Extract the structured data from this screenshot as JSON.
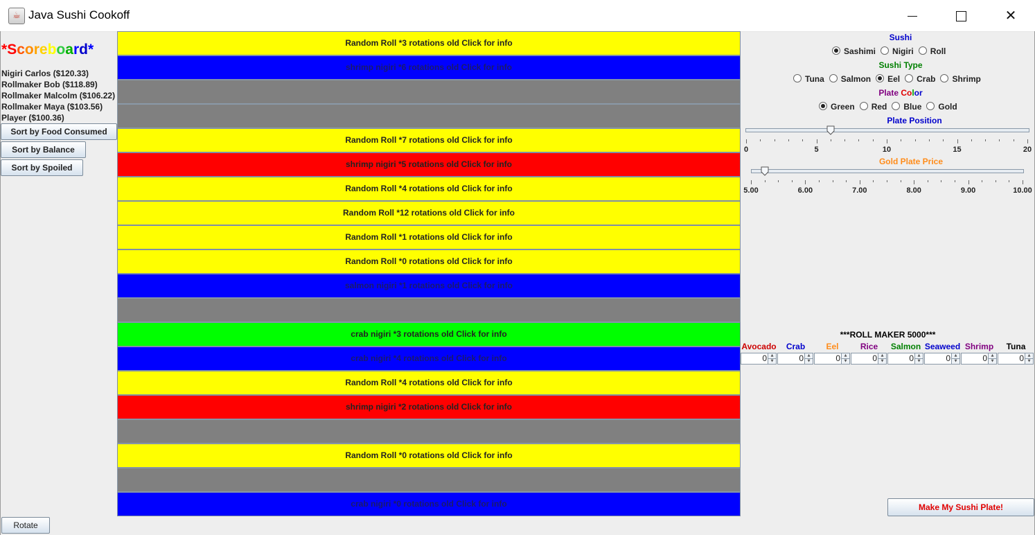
{
  "window": {
    "title": "Java Sushi Cookoff",
    "minimize_glyph": "minimize",
    "maximize_glyph": "maximize",
    "close_glyph": "✕"
  },
  "scoreboard": {
    "title_chars": [
      "*",
      "S",
      "c",
      "o",
      "r",
      "e",
      "b",
      "o",
      "a",
      "r",
      "d",
      "*"
    ],
    "title_colors": [
      "#ff0000",
      "#ff0000",
      "#ff5500",
      "#ff8c00",
      "#ffa500",
      "#ffd200",
      "#ffff00",
      "#2ecc40",
      "#00b000",
      "#0000ff",
      "#0000cc",
      "#0000ff"
    ],
    "entries": [
      "Nigiri Carlos ($120.33)",
      "Rollmaker Bob ($118.89)",
      "Rollmaker Malcolm ($106.22)",
      "Rollmaker Maya ($103.56)",
      "Player ($100.36)"
    ],
    "sort_food_label": "Sort by Food Consumed",
    "sort_balance_label": "Sort by Balance",
    "sort_spoiled_label": "Sort by Spoiled",
    "rotate_label": "Rotate"
  },
  "belt": {
    "plates": [
      {
        "color": "yellow",
        "text": "Random Roll *3 rotations old Click for info"
      },
      {
        "color": "blue",
        "text": "shrimp nigiri *6 rotations old Click for info"
      },
      {
        "color": "gray",
        "text": ""
      },
      {
        "color": "gray",
        "text": ""
      },
      {
        "color": "yellow",
        "text": "Random Roll *7 rotations old Click for info"
      },
      {
        "color": "red",
        "text": "shrimp nigiri *5 rotations old Click for info"
      },
      {
        "color": "yellow",
        "text": "Random Roll *4 rotations old Click for info"
      },
      {
        "color": "yellow",
        "text": "Random Roll *12 rotations old Click for info"
      },
      {
        "color": "yellow",
        "text": "Random Roll *1 rotations old Click for info"
      },
      {
        "color": "yellow",
        "text": "Random Roll *0 rotations old Click for info"
      },
      {
        "color": "blue",
        "text": "salmon nigiri *1 rotations old Click for info"
      },
      {
        "color": "gray",
        "text": ""
      },
      {
        "color": "green",
        "text": "crab nigiri *3 rotations old Click for info"
      },
      {
        "color": "blue",
        "text": "crab nigiri *4 rotations old Click for info"
      },
      {
        "color": "yellow",
        "text": "Random Roll *4 rotations old Click for info"
      },
      {
        "color": "red",
        "text": "shrimp nigiri *2 rotations old Click for info"
      },
      {
        "color": "gray",
        "text": ""
      },
      {
        "color": "yellow",
        "text": "Random Roll *0 rotations old Click for info"
      },
      {
        "color": "gray",
        "text": ""
      },
      {
        "color": "blue",
        "text": "crab nigiri *0 rotations old Click for info"
      }
    ]
  },
  "controls": {
    "sushi_label": "Sushi",
    "sushi_options": [
      "Sashimi",
      "Nigiri",
      "Roll"
    ],
    "sushi_selected": "Sashimi",
    "type_label": "Sushi Type",
    "type_options": [
      "Tuna",
      "Salmon",
      "Eel",
      "Crab",
      "Shrimp"
    ],
    "type_selected": "Eel",
    "plate_color_label_chars": [
      "Plate ",
      "Co",
      "l",
      "or"
    ],
    "plate_color_label_colors": [
      "#800080",
      "#e00000",
      "#00a000",
      "#0000cc"
    ],
    "color_options": [
      "Green",
      "Red",
      "Blue",
      "Gold"
    ],
    "color_selected": "Green",
    "position_label": "Plate Position",
    "position_value": 6,
    "position_ticks": [
      "0",
      "5",
      "10",
      "15",
      "20"
    ],
    "price_label": "Gold Plate Price",
    "price_value": 5.25,
    "price_ticks": [
      "5.00",
      "6.00",
      "7.00",
      "8.00",
      "9.00",
      "10.00"
    ]
  },
  "roll_maker": {
    "title": "***ROLL MAKER 5000***",
    "ingredients": [
      {
        "name": "Avocado",
        "color": "#cc0000",
        "value": "0"
      },
      {
        "name": "Crab",
        "color": "#0000cc",
        "value": "0"
      },
      {
        "name": "Eel",
        "color": "#ff8c1a",
        "value": "0"
      },
      {
        "name": "Rice",
        "color": "#800080",
        "value": "0"
      },
      {
        "name": "Salmon",
        "color": "#008000",
        "value": "0"
      },
      {
        "name": "Seaweed",
        "color": "#0000cc",
        "value": "0"
      },
      {
        "name": "Shrimp",
        "color": "#800080",
        "value": "0"
      },
      {
        "name": "Tuna",
        "color": "#000000",
        "value": "0"
      }
    ],
    "make_label": "Make My Sushi Plate!"
  }
}
